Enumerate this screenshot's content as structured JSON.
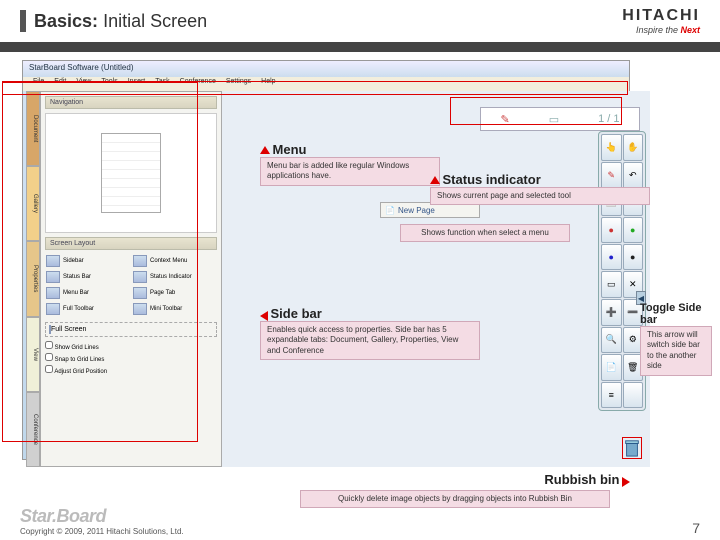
{
  "header": {
    "prefix": "Basics:",
    "title": "Initial Screen",
    "logo": "HITACHI",
    "tagline_a": "Inspire the ",
    "tagline_b": "Next"
  },
  "app": {
    "title": "StarBoard Software (Untitled)",
    "menu": [
      "File",
      "Edit",
      "View",
      "Tools",
      "Insert",
      "Task",
      "Conference",
      "Settings",
      "Help"
    ],
    "sidebar": {
      "tabs": [
        "Document",
        "Gallery",
        "Properties",
        "View",
        "Conference"
      ],
      "nav_header": "Navigation",
      "layout_header": "Screen Layout",
      "layout_items": [
        "Sidebar",
        "Context Menu",
        "Status Bar",
        "Status Indicator",
        "Menu Bar",
        "Page Tab",
        "Full Toolbar",
        "Mini Toolbar"
      ],
      "fullscreen": "Full Screen",
      "opts": [
        "Show Grid Lines",
        "Snap to Grid Lines",
        "Adjust Grid Position"
      ]
    },
    "status": {
      "page": "1 / 1"
    },
    "newpage": "New Page"
  },
  "callouts": {
    "menu_title": "Menu",
    "menu_body": "Menu bar is added like regular Windows applications have.",
    "status_title": "Status indicator",
    "status_body": "Shows current page and selected tool",
    "func_body": "Shows function when select a menu",
    "side_title": "Side bar",
    "side_body": "Enables quick access to properties. Side bar has 5 expandable tabs: Document, Gallery, Properties, View and Conference",
    "toggle_title": "Toggle Side bar",
    "toggle_body": "This arrow will switch side bar to the another side",
    "rubbish_title": "Rubbish bin",
    "rubbish_body": "Quickly delete image objects by dragging objects into Rubbish Bin"
  },
  "footer": {
    "brand": "Star.Board",
    "copyright": "Copyright © 2009, 2011 Hitachi Solutions, Ltd.",
    "page": "7"
  }
}
